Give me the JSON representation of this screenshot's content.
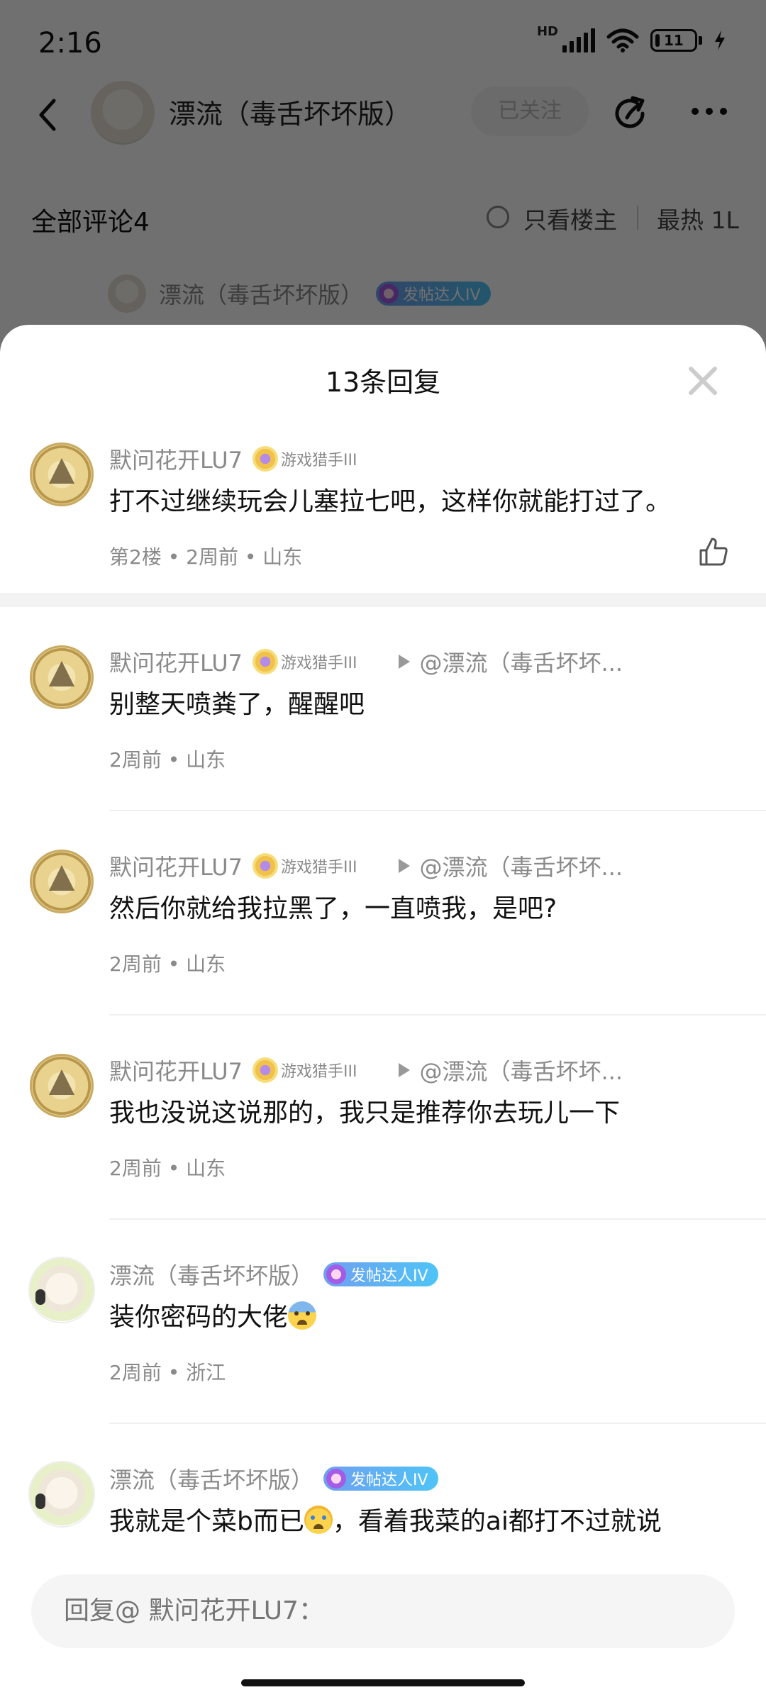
{
  "status_bar": {
    "time": "2:16",
    "network": "HD",
    "battery_level": "11",
    "battery_fraction": 0.11
  },
  "header": {
    "username": "漂流（毒舌坏坏版）",
    "follow_label": "已关注"
  },
  "subbar": {
    "all_comments": "全部评论4",
    "only_op": "只看楼主",
    "sort": "最热 1L"
  },
  "bg_comment": {
    "username": "漂流（毒舌坏坏版）",
    "badge": "发帖达人IV"
  },
  "sheet": {
    "title": "13条回复",
    "main_comment": {
      "username": "默问花开LU7",
      "level": "游戏猎手III",
      "content": "打不过继续玩会儿塞拉七吧，这样你就能打过了。",
      "footer": "第2楼 • 2周前 • 山东"
    },
    "replies": [
      {
        "username": "默问花开LU7",
        "level": "游戏猎手III",
        "reply_to": "@漂流（毒舌坏坏...",
        "content": "别整天喷粪了，醒醒吧",
        "footer": "2周前 • 山东"
      },
      {
        "username": "默问花开LU7",
        "level": "游戏猎手III",
        "reply_to": "@漂流（毒舌坏坏...",
        "content": "然后你就给我拉黑了，一直喷我，是吧?",
        "footer": "2周前 • 山东"
      },
      {
        "username": "默问花开LU7",
        "level": "游戏猎手III",
        "reply_to": "@漂流（毒舌坏坏...",
        "content": "我也没说这说那的，我只是推荐你去玩儿一下",
        "footer": "2周前 • 山东"
      },
      {
        "username": "漂流（毒舌坏坏版）",
        "badge": "发帖达人IV",
        "content": "装你密码的大佬",
        "emoji": "fearful-face",
        "footer": "2周前 • 浙江"
      },
      {
        "username": "漂流（毒舌坏坏版）",
        "badge": "发帖达人IV",
        "content_before": "我就是个菜b而已",
        "emoji": "crying-face",
        "content_after": "，看着我菜的ai都打不过就说"
      }
    ]
  },
  "input": {
    "placeholder": "回复@ 默问花开LU7："
  },
  "colors": {
    "badge_gradient_start": "#6fa0f0",
    "badge_gradient_end": "#4fc4f6",
    "overlay": "#000000"
  }
}
